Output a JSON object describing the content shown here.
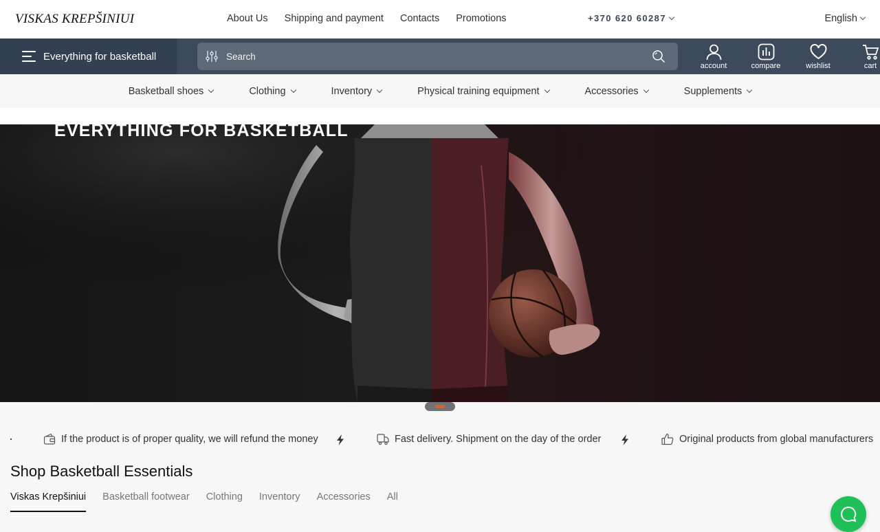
{
  "header": {
    "logo": "VISKAS KREPŠINIUI",
    "links": [
      "About Us",
      "Shipping and payment",
      "Contacts",
      "Promotions"
    ],
    "phone": "+370 620 60287",
    "language": "English"
  },
  "nav": {
    "catalog_label": "Everything for basketball",
    "search_placeholder": "Search",
    "icons": [
      {
        "label": "account",
        "icon": "user-icon"
      },
      {
        "label": "compare",
        "icon": "compare-chart-icon"
      },
      {
        "label": "wishlist",
        "icon": "heart-icon"
      },
      {
        "label": "cart",
        "icon": "cart-icon"
      }
    ]
  },
  "categories": [
    "Basketball shoes",
    "Clothing",
    "Inventory",
    "Physical training equipment",
    "Accessories",
    "Supplements"
  ],
  "hero": {
    "title": "EVERYTHING FOR BASKETBALL"
  },
  "benefits": [
    {
      "text": "If the product is of proper quality, we will refund the money",
      "icon": "refund-wallet-icon"
    },
    {
      "text": "Fast delivery. Shipment on the day of the order",
      "icon": "delivery-truck-icon"
    },
    {
      "text": "Original products from global manufacturers",
      "icon": "thumbs-up-icon"
    }
  ],
  "essentials": {
    "title": "Shop Basketball Essentials",
    "tabs": [
      "Viskas Krepšiniui",
      "Basketball footwear",
      "Clothing",
      "Inventory",
      "Accessories",
      "All"
    ],
    "active_tab": "Viskas Krepšiniui"
  },
  "colors": {
    "dark_bar": "#3d4a5c",
    "accent": "#d9622a",
    "chat": "#20c058"
  }
}
